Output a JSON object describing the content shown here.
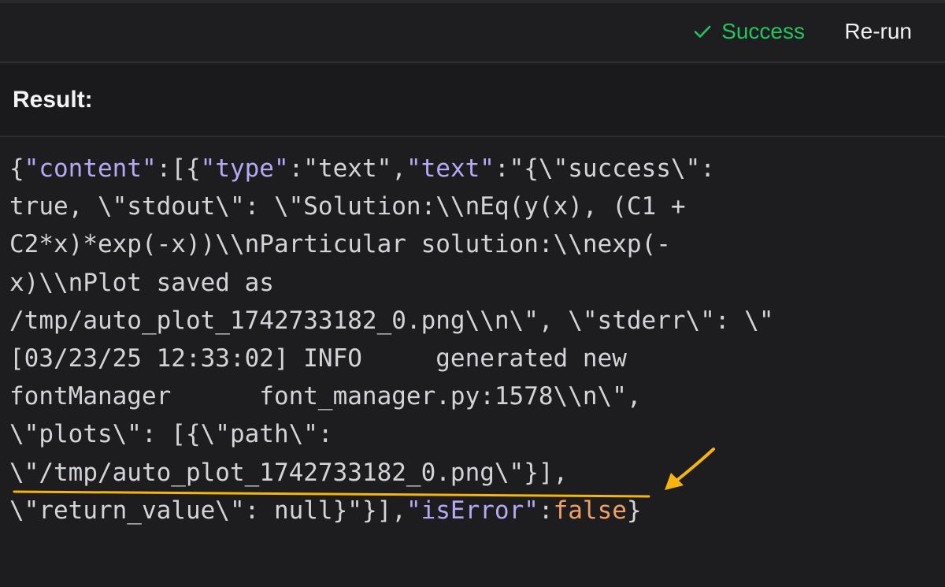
{
  "header": {
    "status_label": "Success",
    "status_color": "#22c55e",
    "rerun_label": "Re-run",
    "status_icon": "check-icon"
  },
  "result": {
    "title": "Result:",
    "lines": {
      "l1": {
        "a": "{",
        "b": "\"content\"",
        "c": ":[{",
        "d": "\"type\"",
        "e": ":\"text\",",
        "f": "\"text\"",
        "g": ":\"{\\\"success\\\":"
      },
      "l2": "true, \\\"stdout\\\": \\\"Solution:\\\\nEq(y(x), (C1 +",
      "l3": "C2*x)*exp(-x))\\\\nParticular solution:\\\\nexp(-",
      "l4": "x)\\\\nPlot saved as",
      "l5": "/tmp/auto_plot_1742733182_0.png\\\\n\\\", \\\"stderr\\\": \\\"",
      "l6": "[03/23/25 12:33:02] INFO     generated new",
      "l7": "fontManager      font_manager.py:1578\\\\n\\\",",
      "l8": "\\\"plots\\\": [{\\\"path\\\":",
      "l9": "\\\"/tmp/auto_plot_1742733182_0.png\\\"}],",
      "l10": {
        "a": "\\\"return_value\\\": null}\"",
        "b": "}],",
        "c": "\"isError\"",
        "d": ":",
        "e": "false",
        "f": "}"
      }
    }
  },
  "annotation": {
    "color": "#f5b50a"
  }
}
